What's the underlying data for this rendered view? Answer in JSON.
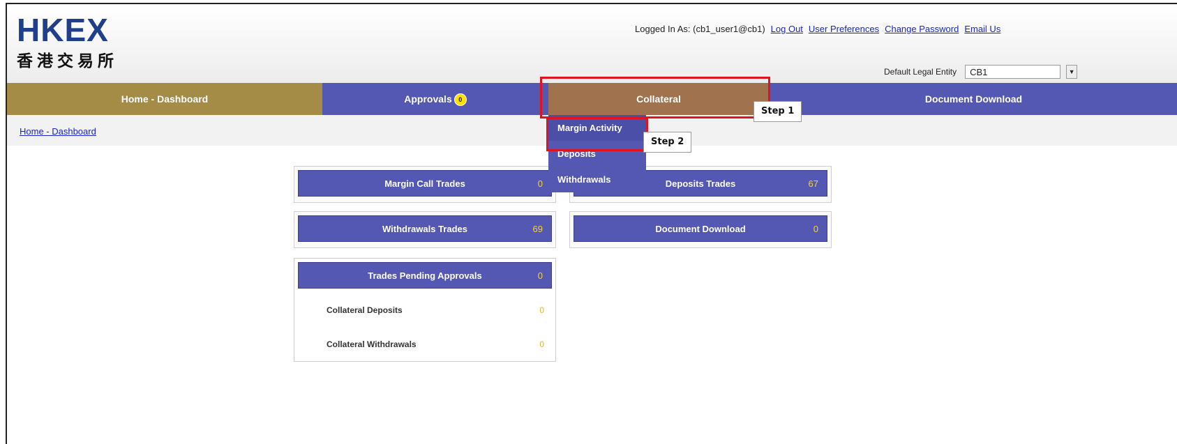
{
  "brand": {
    "logo_en": "HKEX",
    "logo_zh": "香港交易所",
    "primary_color": "#1f3f8a"
  },
  "user_bar": {
    "logged_in_label": "Logged In As: (cb1_user1@cb1)",
    "links": [
      "Log Out",
      "User Preferences",
      "Change Password",
      "Email Us"
    ]
  },
  "entity": {
    "label": "Default Legal Entity",
    "value": "CB1"
  },
  "nav": {
    "home": "Home - Dashboard",
    "approvals": "Approvals",
    "approvals_badge": "0",
    "collateral": "Collateral",
    "documents": "Document Download",
    "colors": {
      "bar": "#5558b2",
      "home_active": "#a48b46",
      "collateral_hover": "#a0724e"
    }
  },
  "breadcrumb": "Home - Dashboard",
  "collateral_menu": [
    "Margin Activity",
    "Deposits",
    "Withdrawals"
  ],
  "callouts": {
    "step1": "Step 1",
    "step2": "Step 2"
  },
  "cards": {
    "margin_call": {
      "label": "Margin Call Trades",
      "count": "0"
    },
    "deposits": {
      "label": "Deposits Trades",
      "count": "67"
    },
    "withdrawals": {
      "label": "Withdrawals Trades",
      "count": "69"
    },
    "documents": {
      "label": "Document Download",
      "count": "0"
    },
    "pending": {
      "label": "Trades Pending Approvals",
      "count": "0",
      "rows": [
        {
          "label": "Collateral Deposits",
          "value": "0"
        },
        {
          "label": "Collateral Withdrawals",
          "value": "0"
        }
      ]
    }
  }
}
